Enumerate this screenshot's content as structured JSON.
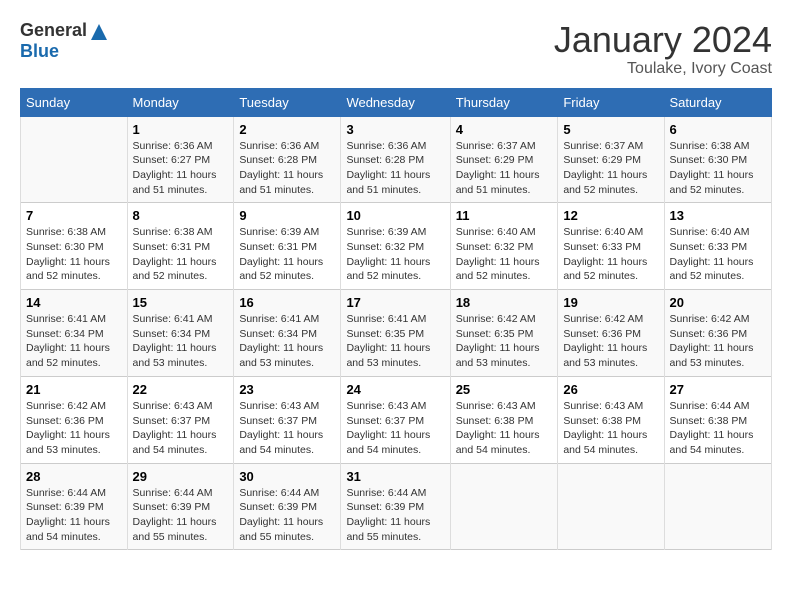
{
  "logo": {
    "general": "General",
    "blue": "Blue"
  },
  "title": "January 2024",
  "location": "Toulake, Ivory Coast",
  "days_of_week": [
    "Sunday",
    "Monday",
    "Tuesday",
    "Wednesday",
    "Thursday",
    "Friday",
    "Saturday"
  ],
  "weeks": [
    [
      {
        "day": "",
        "sunrise": "",
        "sunset": "",
        "daylight": ""
      },
      {
        "day": "1",
        "sunrise": "Sunrise: 6:36 AM",
        "sunset": "Sunset: 6:27 PM",
        "daylight": "Daylight: 11 hours and 51 minutes."
      },
      {
        "day": "2",
        "sunrise": "Sunrise: 6:36 AM",
        "sunset": "Sunset: 6:28 PM",
        "daylight": "Daylight: 11 hours and 51 minutes."
      },
      {
        "day": "3",
        "sunrise": "Sunrise: 6:36 AM",
        "sunset": "Sunset: 6:28 PM",
        "daylight": "Daylight: 11 hours and 51 minutes."
      },
      {
        "day": "4",
        "sunrise": "Sunrise: 6:37 AM",
        "sunset": "Sunset: 6:29 PM",
        "daylight": "Daylight: 11 hours and 51 minutes."
      },
      {
        "day": "5",
        "sunrise": "Sunrise: 6:37 AM",
        "sunset": "Sunset: 6:29 PM",
        "daylight": "Daylight: 11 hours and 52 minutes."
      },
      {
        "day": "6",
        "sunrise": "Sunrise: 6:38 AM",
        "sunset": "Sunset: 6:30 PM",
        "daylight": "Daylight: 11 hours and 52 minutes."
      }
    ],
    [
      {
        "day": "7",
        "sunrise": "Sunrise: 6:38 AM",
        "sunset": "Sunset: 6:30 PM",
        "daylight": "Daylight: 11 hours and 52 minutes."
      },
      {
        "day": "8",
        "sunrise": "Sunrise: 6:38 AM",
        "sunset": "Sunset: 6:31 PM",
        "daylight": "Daylight: 11 hours and 52 minutes."
      },
      {
        "day": "9",
        "sunrise": "Sunrise: 6:39 AM",
        "sunset": "Sunset: 6:31 PM",
        "daylight": "Daylight: 11 hours and 52 minutes."
      },
      {
        "day": "10",
        "sunrise": "Sunrise: 6:39 AM",
        "sunset": "Sunset: 6:32 PM",
        "daylight": "Daylight: 11 hours and 52 minutes."
      },
      {
        "day": "11",
        "sunrise": "Sunrise: 6:40 AM",
        "sunset": "Sunset: 6:32 PM",
        "daylight": "Daylight: 11 hours and 52 minutes."
      },
      {
        "day": "12",
        "sunrise": "Sunrise: 6:40 AM",
        "sunset": "Sunset: 6:33 PM",
        "daylight": "Daylight: 11 hours and 52 minutes."
      },
      {
        "day": "13",
        "sunrise": "Sunrise: 6:40 AM",
        "sunset": "Sunset: 6:33 PM",
        "daylight": "Daylight: 11 hours and 52 minutes."
      }
    ],
    [
      {
        "day": "14",
        "sunrise": "Sunrise: 6:41 AM",
        "sunset": "Sunset: 6:34 PM",
        "daylight": "Daylight: 11 hours and 52 minutes."
      },
      {
        "day": "15",
        "sunrise": "Sunrise: 6:41 AM",
        "sunset": "Sunset: 6:34 PM",
        "daylight": "Daylight: 11 hours and 53 minutes."
      },
      {
        "day": "16",
        "sunrise": "Sunrise: 6:41 AM",
        "sunset": "Sunset: 6:34 PM",
        "daylight": "Daylight: 11 hours and 53 minutes."
      },
      {
        "day": "17",
        "sunrise": "Sunrise: 6:41 AM",
        "sunset": "Sunset: 6:35 PM",
        "daylight": "Daylight: 11 hours and 53 minutes."
      },
      {
        "day": "18",
        "sunrise": "Sunrise: 6:42 AM",
        "sunset": "Sunset: 6:35 PM",
        "daylight": "Daylight: 11 hours and 53 minutes."
      },
      {
        "day": "19",
        "sunrise": "Sunrise: 6:42 AM",
        "sunset": "Sunset: 6:36 PM",
        "daylight": "Daylight: 11 hours and 53 minutes."
      },
      {
        "day": "20",
        "sunrise": "Sunrise: 6:42 AM",
        "sunset": "Sunset: 6:36 PM",
        "daylight": "Daylight: 11 hours and 53 minutes."
      }
    ],
    [
      {
        "day": "21",
        "sunrise": "Sunrise: 6:42 AM",
        "sunset": "Sunset: 6:36 PM",
        "daylight": "Daylight: 11 hours and 53 minutes."
      },
      {
        "day": "22",
        "sunrise": "Sunrise: 6:43 AM",
        "sunset": "Sunset: 6:37 PM",
        "daylight": "Daylight: 11 hours and 54 minutes."
      },
      {
        "day": "23",
        "sunrise": "Sunrise: 6:43 AM",
        "sunset": "Sunset: 6:37 PM",
        "daylight": "Daylight: 11 hours and 54 minutes."
      },
      {
        "day": "24",
        "sunrise": "Sunrise: 6:43 AM",
        "sunset": "Sunset: 6:37 PM",
        "daylight": "Daylight: 11 hours and 54 minutes."
      },
      {
        "day": "25",
        "sunrise": "Sunrise: 6:43 AM",
        "sunset": "Sunset: 6:38 PM",
        "daylight": "Daylight: 11 hours and 54 minutes."
      },
      {
        "day": "26",
        "sunrise": "Sunrise: 6:43 AM",
        "sunset": "Sunset: 6:38 PM",
        "daylight": "Daylight: 11 hours and 54 minutes."
      },
      {
        "day": "27",
        "sunrise": "Sunrise: 6:44 AM",
        "sunset": "Sunset: 6:38 PM",
        "daylight": "Daylight: 11 hours and 54 minutes."
      }
    ],
    [
      {
        "day": "28",
        "sunrise": "Sunrise: 6:44 AM",
        "sunset": "Sunset: 6:39 PM",
        "daylight": "Daylight: 11 hours and 54 minutes."
      },
      {
        "day": "29",
        "sunrise": "Sunrise: 6:44 AM",
        "sunset": "Sunset: 6:39 PM",
        "daylight": "Daylight: 11 hours and 55 minutes."
      },
      {
        "day": "30",
        "sunrise": "Sunrise: 6:44 AM",
        "sunset": "Sunset: 6:39 PM",
        "daylight": "Daylight: 11 hours and 55 minutes."
      },
      {
        "day": "31",
        "sunrise": "Sunrise: 6:44 AM",
        "sunset": "Sunset: 6:39 PM",
        "daylight": "Daylight: 11 hours and 55 minutes."
      },
      {
        "day": "",
        "sunrise": "",
        "sunset": "",
        "daylight": ""
      },
      {
        "day": "",
        "sunrise": "",
        "sunset": "",
        "daylight": ""
      },
      {
        "day": "",
        "sunrise": "",
        "sunset": "",
        "daylight": ""
      }
    ]
  ]
}
